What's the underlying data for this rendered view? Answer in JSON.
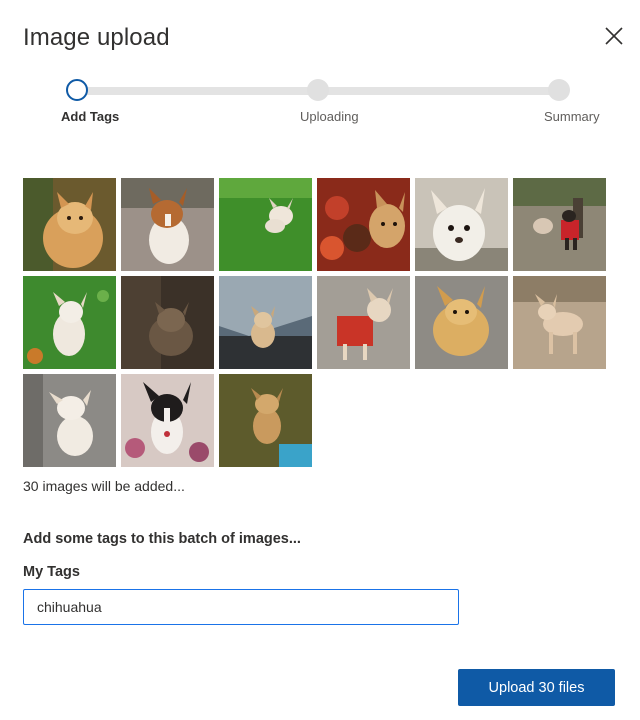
{
  "dialog": {
    "title": "Image upload",
    "close_icon": "close-icon"
  },
  "stepper": {
    "steps": [
      {
        "label": "Add Tags",
        "state": "active"
      },
      {
        "label": "Uploading",
        "state": "pending"
      },
      {
        "label": "Summary",
        "state": "pending"
      }
    ]
  },
  "images": {
    "thumbnails": [
      {
        "name": "chihuahua-photo-1"
      },
      {
        "name": "chihuahua-photo-2"
      },
      {
        "name": "chihuahua-photo-3"
      },
      {
        "name": "chihuahua-photo-4"
      },
      {
        "name": "chihuahua-photo-5"
      },
      {
        "name": "chihuahua-photo-6"
      },
      {
        "name": "chihuahua-photo-7"
      },
      {
        "name": "chihuahua-photo-8"
      },
      {
        "name": "chihuahua-photo-9"
      },
      {
        "name": "chihuahua-photo-10"
      },
      {
        "name": "chihuahua-photo-11"
      },
      {
        "name": "chihuahua-photo-12"
      },
      {
        "name": "chihuahua-photo-13"
      },
      {
        "name": "chihuahua-photo-14"
      },
      {
        "name": "chihuahua-photo-15"
      }
    ],
    "count_text": "30 images will be added..."
  },
  "tags": {
    "heading": "Add some tags to this batch of images...",
    "label": "My Tags",
    "value": "chihuahua"
  },
  "footer": {
    "upload_label": "Upload 30 files"
  },
  "colors": {
    "accent": "#0f5aa6",
    "input_border": "#1a73e8",
    "track": "#e3e3e3"
  }
}
